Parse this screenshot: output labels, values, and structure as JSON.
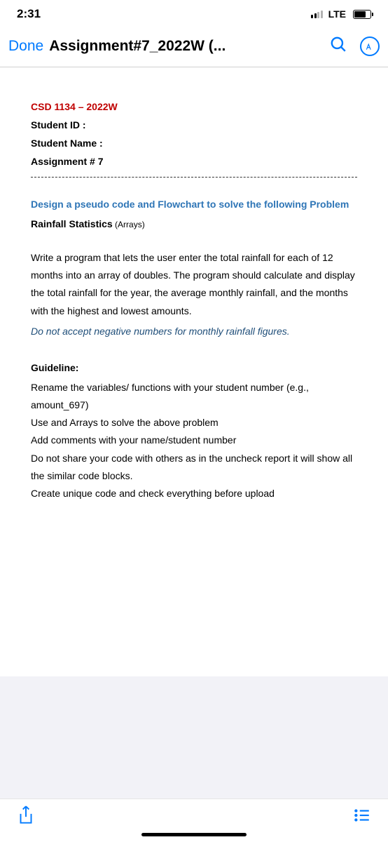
{
  "status": {
    "time": "2:31",
    "network": "LTE"
  },
  "nav": {
    "done": "Done",
    "title": "Assignment#7_2022W (..."
  },
  "doc": {
    "course": "CSD 1134 – 2022W",
    "student_id_label": "Student ID :",
    "student_name_label": "Student Name :",
    "assignment_label": "Assignment # 7",
    "problem_title": "Design a pseudo code and Flowchart to solve the following Problem",
    "subtitle_main": "Rainfall Statistics",
    "subtitle_paren": " (Arrays)",
    "body": "Write a program that lets the user enter the total rainfall for each of 12 months into an array of doubles. The program should calculate and display the total rainfall for the year, the average monthly rainfall, and the months with the highest and lowest amounts.",
    "note": "Do not accept negative numbers for monthly rainfall figures.",
    "guideline_header": "Guideline:",
    "g1": "Rename the variables/ functions with your student number (e.g., amount_697)",
    "g2": "Use and Arrays to solve the above problem",
    "g3": "Add comments with your name/student number",
    "g4": "Do not share your code with others as in the uncheck report it will show all the similar code blocks.",
    "g5": "Create unique code and check everything before upload"
  }
}
